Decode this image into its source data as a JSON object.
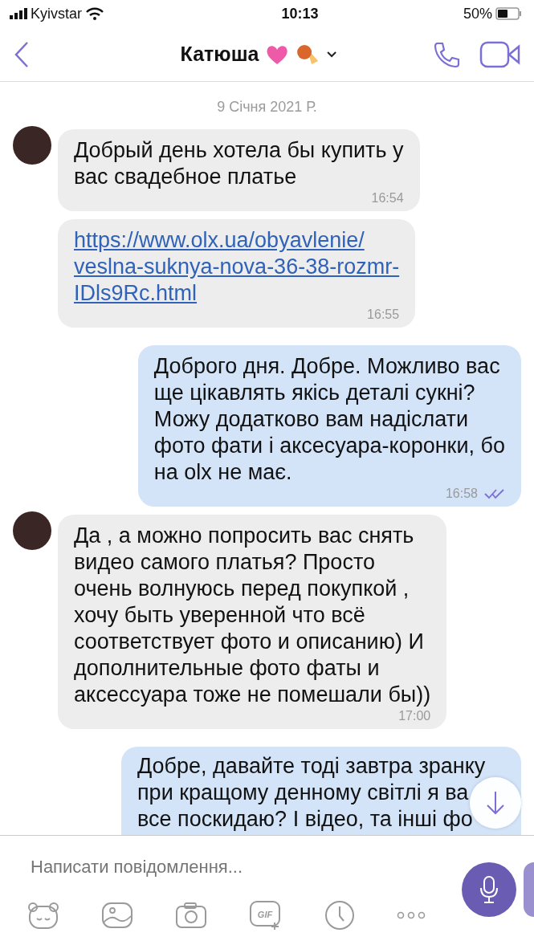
{
  "status_bar": {
    "carrier": "Kyivstar",
    "time": "10:13",
    "battery": "50%"
  },
  "header": {
    "title": "Катюша"
  },
  "date_separator": "9 Січня 2021 Р.",
  "messages": [
    {
      "kind": "text",
      "incoming": true,
      "avatar": true,
      "text": "Добрый день хотела бы купить у\nвас свадебное платье",
      "time": "16:54"
    },
    {
      "kind": "link",
      "incoming": true,
      "avatar": false,
      "text": "https://www.olx.ua/obyavlenie/\nveslna-suknya-nova-36-38-rozmr-\nIDls9Rc.html",
      "time": "16:55"
    },
    {
      "kind": "text",
      "incoming": false,
      "read": true,
      "text": "Доброго дня. Добре. Можливо вас\nще цікавлять якісь деталі сукні?\nМожу додатково вам надіслати\nфото фати і аксесуара-коронки, бо\nна olx не має.",
      "time": "16:58"
    },
    {
      "kind": "text",
      "incoming": true,
      "avatar": true,
      "text": "Да , а можно попросить вас снять\nвидео самого платья? Просто\nочень волнуюсь перед покупкой ,\nхочу быть уверенной что всё\nсоответствует фото и описанию) И\nдополнительные фото фаты и\nаксессуара тоже не помешали бы))",
      "time": "17:00"
    },
    {
      "kind": "cut",
      "incoming": false,
      "lines": [
        "Добре, давайте тоді завтра зранку",
        "при кращому денному світлі я ва",
        "все поскидаю? І відео, та інші фо"
      ]
    }
  ],
  "composer": {
    "placeholder": "Написати повідомлення...",
    "gif_label": "GIF"
  }
}
